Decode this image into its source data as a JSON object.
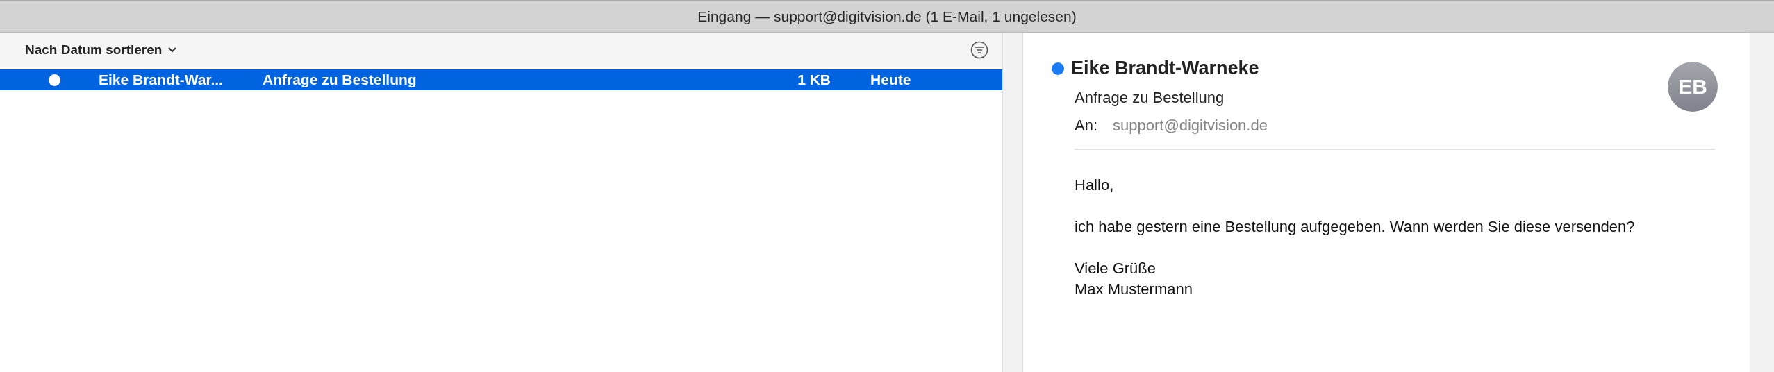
{
  "window": {
    "title": "Eingang — support@digitvision.de (1 E-Mail, 1 ungelesen)"
  },
  "message_list": {
    "sort_label": "Nach Datum sortieren",
    "messages": [
      {
        "sender": "Eike Brandt-War...",
        "subject": "Anfrage zu Bestellung",
        "size": "1 KB",
        "date": "Heute",
        "unread": true,
        "selected": true
      }
    ]
  },
  "reader": {
    "sender": "Eike Brandt-Warneke",
    "unread": true,
    "subject": "Anfrage zu Bestellung",
    "to_label": "An:",
    "to": "support@digitvision.de",
    "avatar": "EB",
    "body": [
      "Hallo,",
      "ich habe gestern eine Bestellung aufgegeben. Wann werden Sie diese versenden?",
      [
        "Viele Grüße",
        "Max Mustermann"
      ]
    ]
  }
}
